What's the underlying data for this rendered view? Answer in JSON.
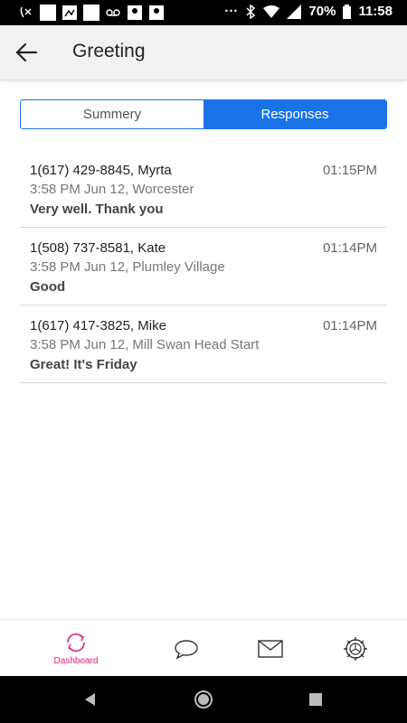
{
  "status_bar": {
    "battery": "70%",
    "time": "11:58"
  },
  "header": {
    "title": "Greeting"
  },
  "segment": {
    "summary_label": "Summery",
    "responses_label": "Responses"
  },
  "responses": [
    {
      "contact": "1(617) 429-8845, Myrta",
      "time": "01:15PM",
      "meta": "3:58 PM Jun 12, Worcester",
      "message": "Very well. Thank you"
    },
    {
      "contact": "1(508) 737-8581, Kate",
      "time": "01:14PM",
      "meta": "3:58 PM Jun 12, Plumley Village",
      "message": "Good"
    },
    {
      "contact": "1(617) 417-3825, Mike",
      "time": "01:14PM",
      "meta": "3:58 PM Jun 12, Mill Swan Head Start",
      "message": "Great! It's Friday"
    }
  ],
  "bottom_nav": {
    "dashboard_label": "Dashboard"
  },
  "colors": {
    "accent": "#1a73e8",
    "nav_active": "#e0207a"
  }
}
